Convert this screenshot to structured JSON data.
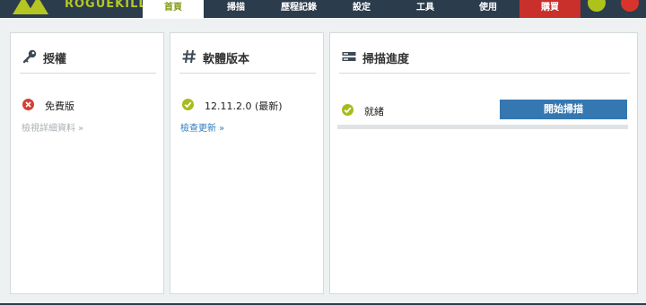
{
  "app": {
    "logo_text": "ROGUEKILLER"
  },
  "tabs": [
    {
      "label": "首頁",
      "active": true
    },
    {
      "label": "掃描"
    },
    {
      "label": "歷程記錄"
    },
    {
      "label": "設定"
    },
    {
      "label": "工具"
    },
    {
      "label": "使用"
    },
    {
      "label": "購買"
    }
  ],
  "license": {
    "title": "授權",
    "status": "免費版",
    "link": "檢視詳細資料 »",
    "icon": "key-icon",
    "status_icon": "error-x-icon"
  },
  "version": {
    "title": "軟體版本",
    "value": "12.11.2.0 (最新)",
    "link": "檢查更新 »",
    "icon": "hash-icon",
    "status_icon": "check-icon"
  },
  "scan": {
    "title": "掃描進度",
    "status": "就緒",
    "button": "開始掃描",
    "progress": 0,
    "icon": "server-icon",
    "status_icon": "check-icon"
  },
  "colors": {
    "topbar": "#2b3c4c",
    "accent_green": "#aec21c",
    "buy_red": "#c9302c",
    "button_blue": "#3578b1"
  }
}
